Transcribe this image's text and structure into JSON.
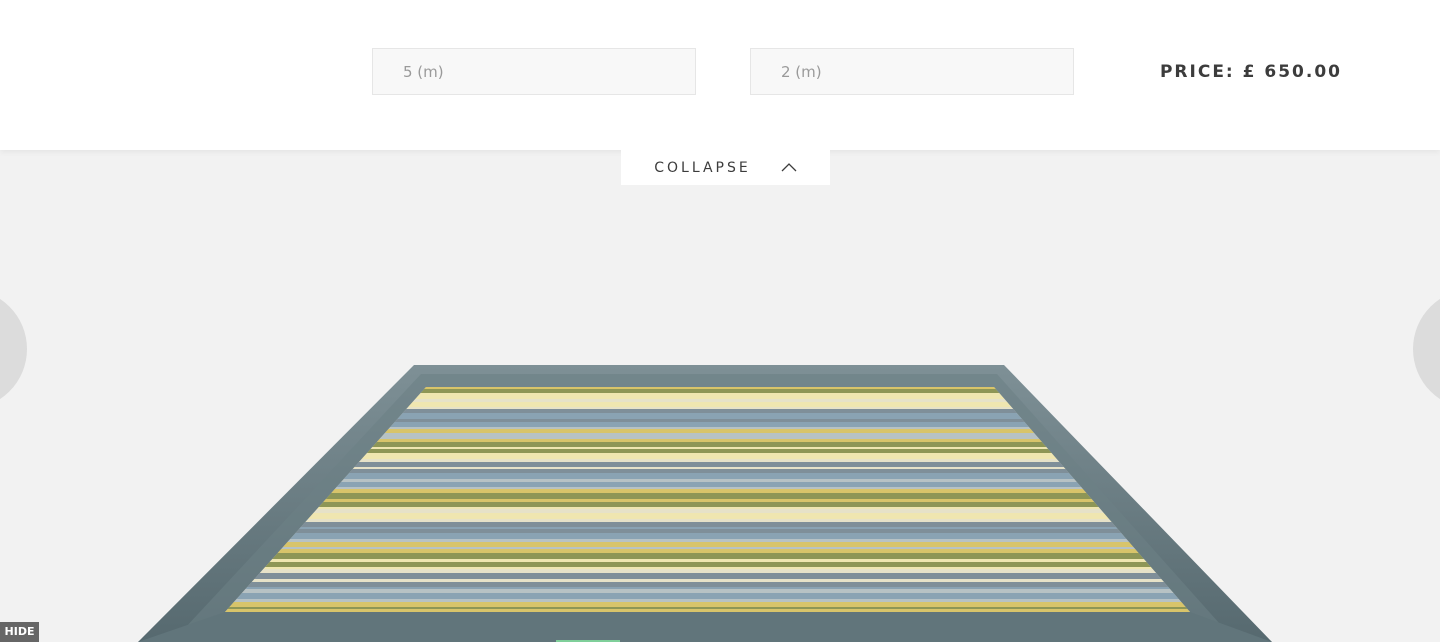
{
  "config_bar": {
    "length_value": "5  (m)",
    "width_value": "2 (m)",
    "price_label": "PRICE: £ 650.00"
  },
  "collapse": {
    "label": "COLLAPSE",
    "icon": "chevron-up-icon"
  },
  "viewer": {
    "prev_icon": "arrow-left-icon",
    "next_icon": "arrow-right-icon",
    "product": "striped rug 3d preview",
    "colors": {
      "border": "#5f7379",
      "stripe_yellow": "#d8c46a",
      "stripe_blue": "#8aa3b3",
      "stripe_olive": "#8e9656"
    }
  },
  "hide_button": {
    "label": "HIDE"
  }
}
